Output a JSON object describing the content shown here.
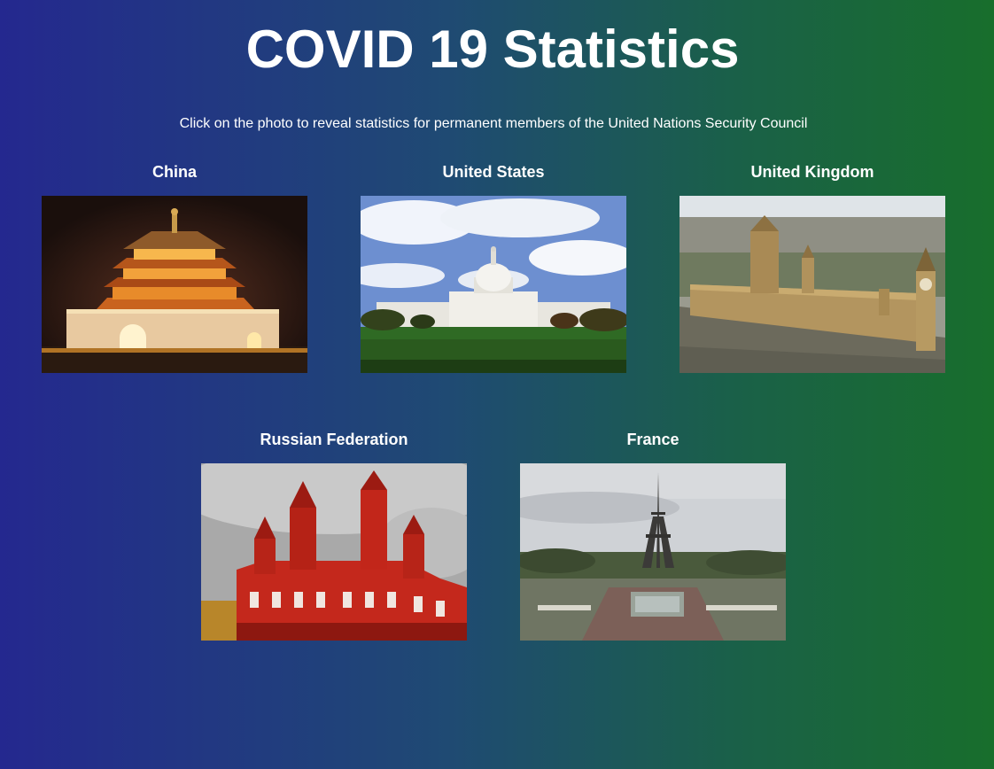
{
  "page": {
    "title": "COVID 19 Statistics",
    "subtitle": "Click on the photo to reveal statistics for permanent members of the United Nations Security Council"
  },
  "countries": [
    {
      "name": "China",
      "photo_icon": "bell-tower-photo"
    },
    {
      "name": "United States",
      "photo_icon": "capitol-photo"
    },
    {
      "name": "United Kingdom",
      "photo_icon": "westminster-photo"
    },
    {
      "name": "Russian Federation",
      "photo_icon": "historical-museum-photo"
    },
    {
      "name": "France",
      "photo_icon": "eiffel-tower-photo"
    }
  ],
  "colors": {
    "gradient_start": "#24288f",
    "gradient_end": "#186e2c",
    "text": "#ffffff"
  }
}
